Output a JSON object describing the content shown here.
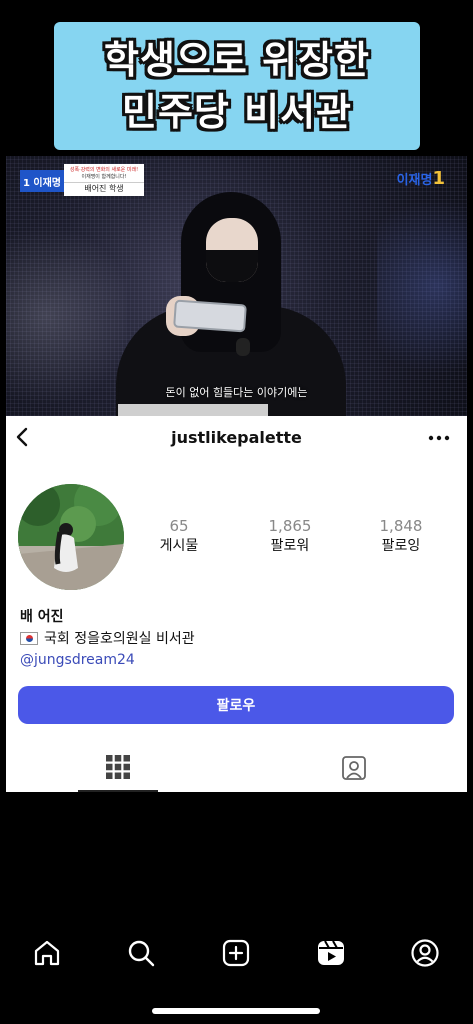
{
  "banner": {
    "line1": "학생으로 위장한",
    "line2": "민주당 비서관"
  },
  "video": {
    "news_logo": "1 이재명",
    "caption_top": "성폭·강력의 변화의 새로운 미래!",
    "caption_sub": "이재명이 함께합니다!",
    "caption_name": "배어진 학생",
    "channel_mark": "이재명",
    "channel_mark_num": "1",
    "subtitle": "돈이 없어 힘들다는 이야기에는"
  },
  "profile": {
    "username": "justlikepalette",
    "stats": [
      {
        "value": "65",
        "label": "게시물"
      },
      {
        "value": "1,865",
        "label": "팔로워"
      },
      {
        "value": "1,848",
        "label": "팔로잉"
      }
    ],
    "name": "배 어진",
    "bio": "국회 정을호의원실 비서관",
    "link": "@jungsdream24",
    "follow_label": "팔로우"
  },
  "icons": {
    "back": "back-arrow-icon",
    "more": "more-options-icon",
    "grid": "grid-icon",
    "tagged": "tagged-icon",
    "nav": [
      "home-icon",
      "search-icon",
      "create-icon",
      "reels-icon",
      "profile-icon"
    ]
  },
  "colors": {
    "banner_bg": "#86d5f1",
    "follow_btn": "#4b58e8",
    "link": "#3b4bb8"
  }
}
